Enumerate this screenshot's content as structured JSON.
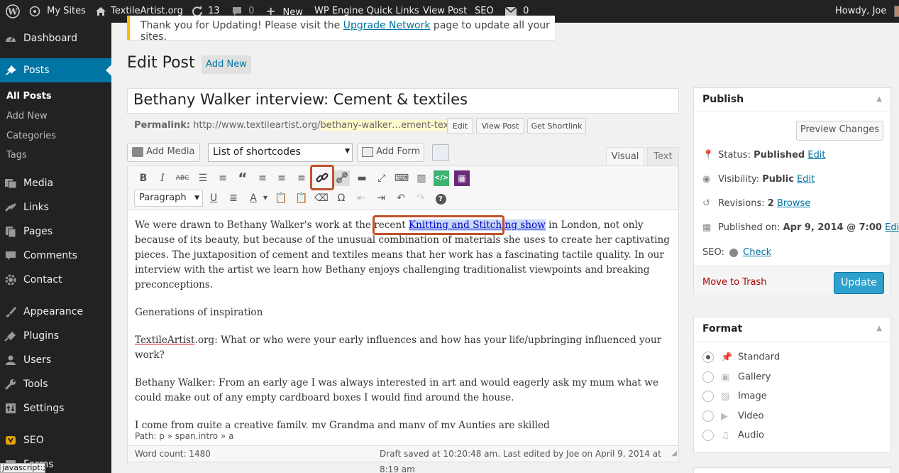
{
  "adminbar": {
    "my_sites": "My Sites",
    "site_name": "TextileArtist.org",
    "updates_count": "13",
    "comments_count": "0",
    "new_label": "New",
    "quick_links": "WP Engine Quick Links",
    "view_post": "View Post",
    "seo": "SEO",
    "messages_count": "0",
    "howdy": "Howdy, Joe"
  },
  "sidebar": {
    "items": [
      {
        "label": "Dashboard",
        "icon": "dashboard-icon"
      },
      {
        "label": "Posts",
        "icon": "pin-icon"
      },
      {
        "label": "Media",
        "icon": "media-icon"
      },
      {
        "label": "Links",
        "icon": "link-icon"
      },
      {
        "label": "Pages",
        "icon": "pages-icon"
      },
      {
        "label": "Comments",
        "icon": "comment-icon"
      },
      {
        "label": "Contact",
        "icon": "gear-icon"
      },
      {
        "label": "Appearance",
        "icon": "brush-icon"
      },
      {
        "label": "Plugins",
        "icon": "plug-icon"
      },
      {
        "label": "Users",
        "icon": "users-icon"
      },
      {
        "label": "Tools",
        "icon": "wrench-icon"
      },
      {
        "label": "Settings",
        "icon": "settings-icon"
      },
      {
        "label": "SEO",
        "icon": "yoast-icon"
      },
      {
        "label": "Forms",
        "icon": "forms-icon"
      }
    ],
    "posts_sub": [
      "All Posts",
      "Add New",
      "Categories",
      "Tags"
    ]
  },
  "notice": {
    "prefix": "Thank you for Updating! Please visit the ",
    "link": "Upgrade Network",
    "suffix": " page to update all your sites."
  },
  "page": {
    "heading": "Edit Post",
    "add_new": "Add New",
    "post_title": "Bethany Walker interview: Cement & textiles",
    "permalink_label": "Permalink:",
    "permalink_base": "http://www.textileartist.org/",
    "permalink_slug": "bethany-walker…ement-textiles",
    "permalink_trail": "/",
    "edit_btn": "Edit",
    "view_post_btn": "View Post",
    "shortlink_btn": "Get Shortlink"
  },
  "media": {
    "add_media": "Add Media",
    "shortcodes": "List of shortcodes",
    "add_form": "Add Form",
    "tab_visual": "Visual",
    "tab_text": "Text"
  },
  "editor": {
    "format": "Paragraph",
    "p1_before": "We were drawn to Bethany Walker's work at the recent ",
    "p1_link": "Knitting and Stitching show",
    "p1_after": " in London, not only because of its beauty, but because of the unusual combination of materials she uses to create her captivating pieces. The juxtaposition of cement and textiles means that her work has a fascinating tactile quality. In our interview with the artist we learn how Bethany enjoys challenging traditionalist viewpoints and breaking preconceptions.",
    "p2": "Generations of inspiration",
    "p3_site": "TextileArtist",
    "p3_rest": ".org: What or who were your early influences and how has your life/upbringing influenced your work?",
    "p4": "Bethany Walker: From an early age I was always interested in art and would eagerly ask my mum what we could make out of any empty cardboard boxes I would find around the house.",
    "p5": "I come from quite a creative family, my Grandma and many of my Aunties are skilled embroiderers/seamstresses; having made their own clothes and items for the home for a number of years. I have fond memories of visiting my Grandma when I was young; we would sit and make pompoms together, for cushions she had made, drinking tea by the gallon – a real",
    "path": "Path: p » span.intro » a",
    "word_count": "Word count: 1480",
    "draft_saved": "Draft saved at 10:20:48 am. Last edited by Joe on April 9, 2014 at 8:19 am"
  },
  "publish": {
    "title": "Publish",
    "preview": "Preview Changes",
    "status_label": "Status:",
    "status_value": "Published",
    "visibility_label": "Visibility:",
    "visibility_value": "Public",
    "revisions_label": "Revisions:",
    "revisions_value": "2",
    "browse": "Browse",
    "published_on_label": "Published on:",
    "published_on_value": "Apr 9, 2014 @ 7:00",
    "edit": "Edit",
    "seo_label": "SEO:",
    "check": "Check",
    "trash": "Move to Trash",
    "update": "Update"
  },
  "format": {
    "title": "Format",
    "options": [
      "Standard",
      "Gallery",
      "Image",
      "Video",
      "Audio"
    ],
    "selected": "Standard"
  },
  "statusbar_text": "javascript:;",
  "colors": {
    "accent": "#0074a2",
    "highlight_box": "#c0522b",
    "update_btn": "#2ea2cc",
    "trash": "#a00"
  }
}
